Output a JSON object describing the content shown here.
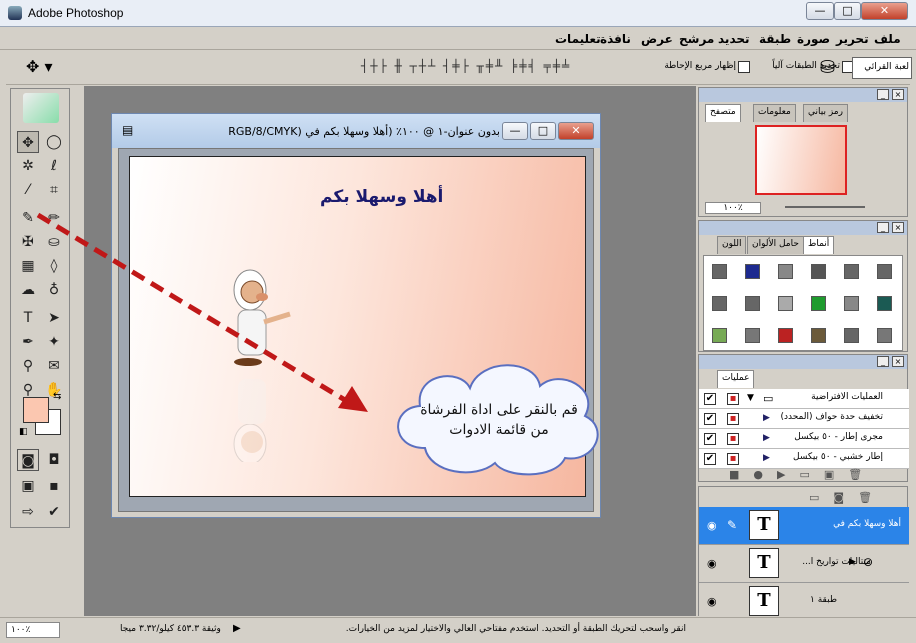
{
  "app": {
    "title": "Adobe Photoshop"
  },
  "menu": [
    "ملف",
    "تحرير",
    "صورة",
    "طبقة",
    "تحديد",
    "مرشح",
    "عرض",
    "نافذة",
    "تعليمات"
  ],
  "options": {
    "auto_select_layer": "تحديد الطبقات آلياً",
    "show_bounding_box": "إظهار مربع الإحاطة",
    "workspace_field": "لعبة القرائي"
  },
  "document": {
    "title": "بدون عنوان-١ @ ١٠٠٪ (أهلا وسهلا بكم في  (RGB/8/CMYK",
    "greeting": "أهلا وسهلا بكم"
  },
  "callout": {
    "text": "قم بالنقر على اداة الفرشاة من قائمة الادوات"
  },
  "navigator": {
    "tabs": [
      "رمز بياني",
      "معلومات",
      "متصفح"
    ],
    "zoom": "١٠٠٪"
  },
  "styles_panel": {
    "tabs": [
      "أنماط",
      "حامل الألوان",
      "اللون"
    ]
  },
  "actions_panel": {
    "tabs": [
      "عمليات"
    ],
    "items": [
      "العمليات الافتراضية",
      "تخفيف حدة حواف (المحدد)",
      "مجرى إطار - ٥٠ بيكسل",
      "إطار خشبي - ٥٠ بيكسل"
    ]
  },
  "layers_panel": {
    "layers": [
      {
        "name": "أهلا وسهلا بكم في",
        "thumb": "T"
      },
      {
        "name": "متتاليات تواريخ ا...",
        "thumb": "T"
      },
      {
        "name": "طبقة ١",
        "thumb": "T"
      }
    ]
  },
  "status": {
    "zoom": "١٠٠٪",
    "doc_size": "وثيقة ٤٥٣.٣ كيلو/٣.٣٢ ميجا",
    "hint": "انقر واسحب لتحريك الطبقة أو التحديد. استخدم مفتاحي العالي والاختيار لمزيد من الخيارات."
  },
  "colors": {
    "foreground": "#fbc7b0",
    "background": "#ffffff",
    "arrow": "#c01818",
    "selection": "#2b84e8"
  }
}
